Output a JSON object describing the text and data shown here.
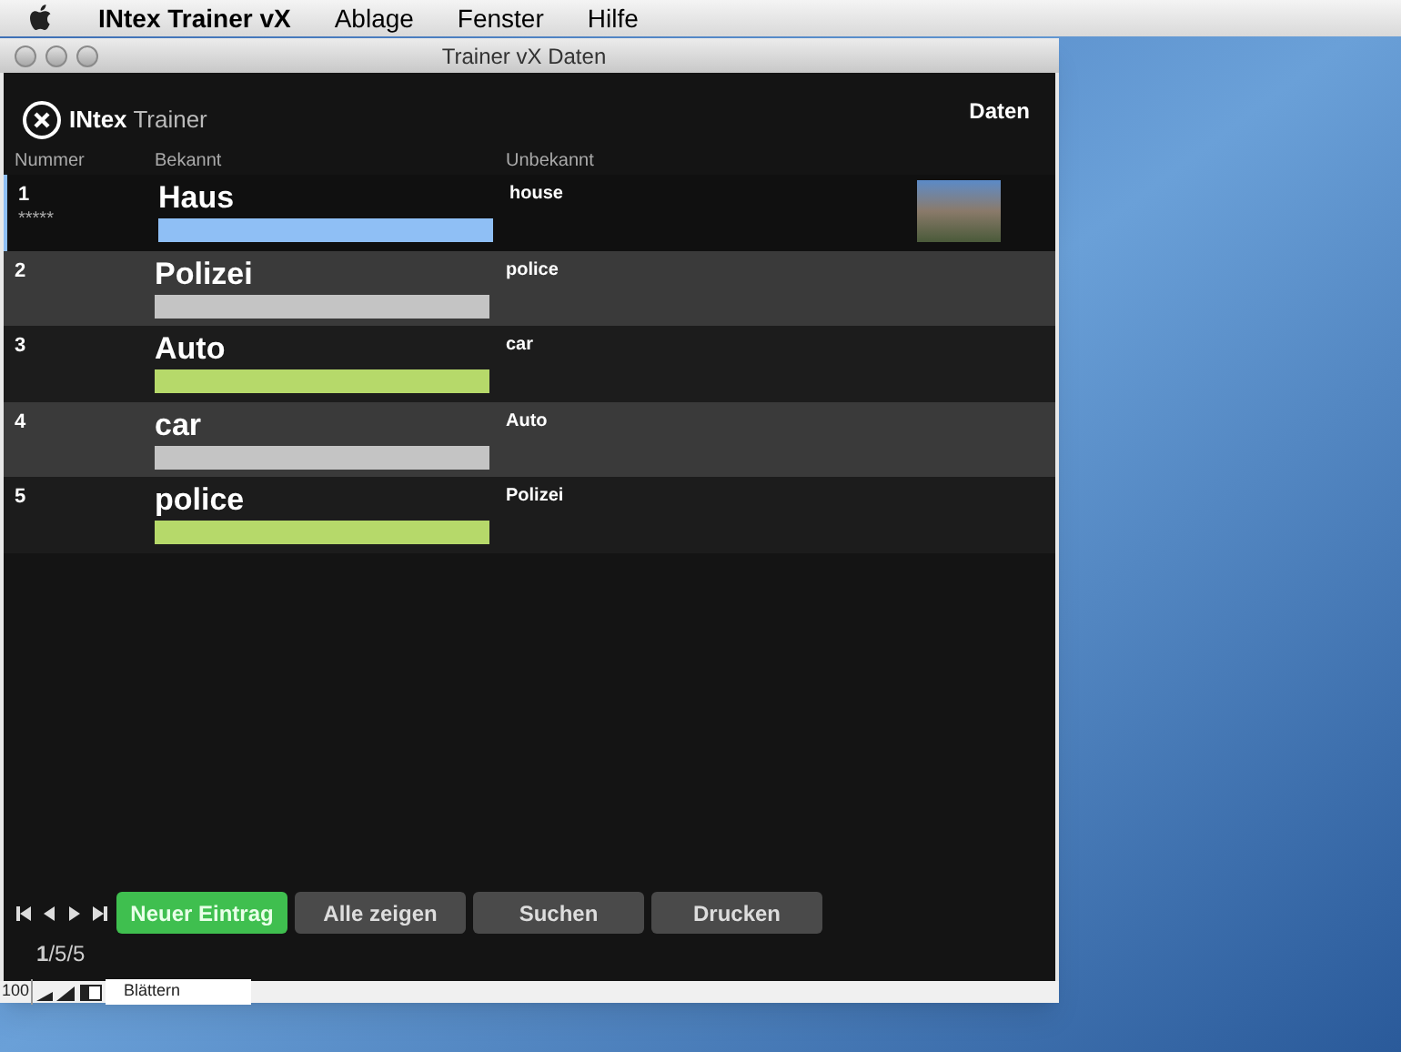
{
  "menu_bar": {
    "app_name": "INtex Trainer vX",
    "items": [
      "Ablage",
      "Fenster",
      "Hilfe"
    ]
  },
  "window": {
    "title": "Trainer vX Daten"
  },
  "header": {
    "brand_bold": "INtex",
    "brand_light": "Trainer",
    "section": "Daten"
  },
  "table": {
    "columns": [
      "Nummer",
      "Bekannt",
      "Unbekannt"
    ],
    "rows": [
      {
        "number": "1",
        "stars": "*****",
        "known": "Haus",
        "unknown": "house",
        "color": "#8fbff5",
        "selected": true,
        "has_photo": true
      },
      {
        "number": "2",
        "known": "Polizei",
        "unknown": "police",
        "color": "#c4c4c4",
        "selected": false,
        "has_photo": false
      },
      {
        "number": "3",
        "known": "Auto",
        "unknown": "car",
        "color": "#b6d96a",
        "selected": false,
        "has_photo": false
      },
      {
        "number": "4",
        "known": "car",
        "unknown": "Auto",
        "color": "#c4c4c4",
        "selected": false,
        "has_photo": false
      },
      {
        "number": "5",
        "known": "police",
        "unknown": "Polizei",
        "color": "#b6d96a",
        "selected": false,
        "has_photo": false
      }
    ]
  },
  "footer": {
    "buttons": [
      {
        "label": "Neuer Eintrag",
        "kind": "primary"
      },
      {
        "label": "Alle zeigen",
        "kind": "normal"
      },
      {
        "label": "Suchen",
        "kind": "normal"
      },
      {
        "label": "Drucken",
        "kind": "normal"
      }
    ],
    "record_counter": "**1**/5/5"
  },
  "status_bar": {
    "zoom": "100",
    "mode": "Blättern"
  }
}
